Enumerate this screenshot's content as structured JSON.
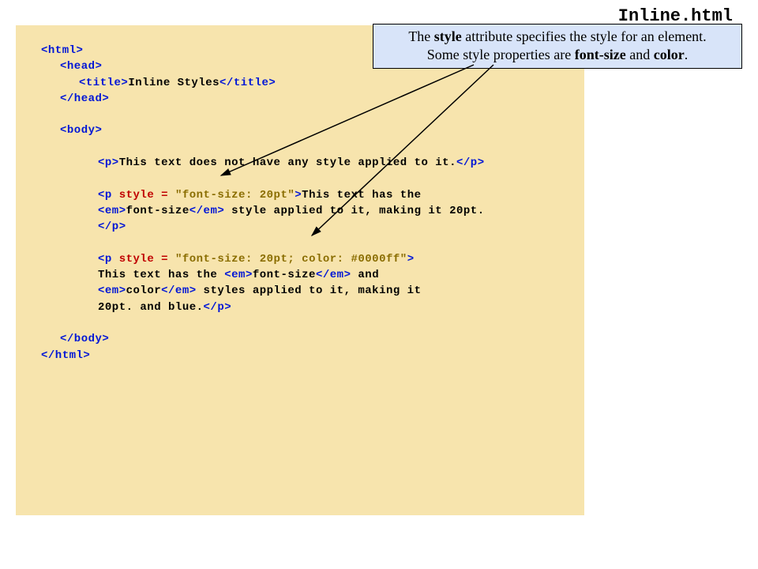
{
  "filename": "Inline.html",
  "callout": {
    "line1_pre": "The ",
    "line1_b1": "style",
    "line1_mid": " attribute specifies the style for an element.",
    "line2_pre": "Some style properties are ",
    "line2_b1": "font-size",
    "line2_mid": " and ",
    "line2_b2": "color",
    "line2_post": "."
  },
  "code": {
    "t_html_o": "<html>",
    "t_head_o": "<head>",
    "t_title_o": "<title>",
    "title_text": "Inline Styles",
    "t_title_c": "</title>",
    "t_head_c": "</head>",
    "t_body_o": "<body>",
    "t_p_o": "<p>",
    "p1_text": "This text does not have any style applied to it.",
    "t_p_c": "</p>",
    "p2_tag_open": "<p ",
    "p2_attr": "style = ",
    "p2_val": "\"font-size: 20pt\"",
    "p2_tag_close_gt": ">",
    "p2_text_a": "This text has the ",
    "t_em_o": "<em>",
    "p2_em_text": "font-size",
    "t_em_c": "</em>",
    "p2_text_b": " style applied to it, making it 20pt.",
    "p3_tag_open": "<p ",
    "p3_attr": "style = ",
    "p3_val": "\"font-size: 20pt; color: #0000ff\"",
    "p3_tag_close_gt": ">",
    "p3_text_a": "This text has the ",
    "p3_em1": "font-size",
    "p3_text_b": " and ",
    "p3_em2": "color",
    "p3_text_c": " styles applied to it, making it",
    "p3_text_d": "20pt. and blue.",
    "t_body_c": "</body>",
    "t_html_c": "</html>"
  }
}
